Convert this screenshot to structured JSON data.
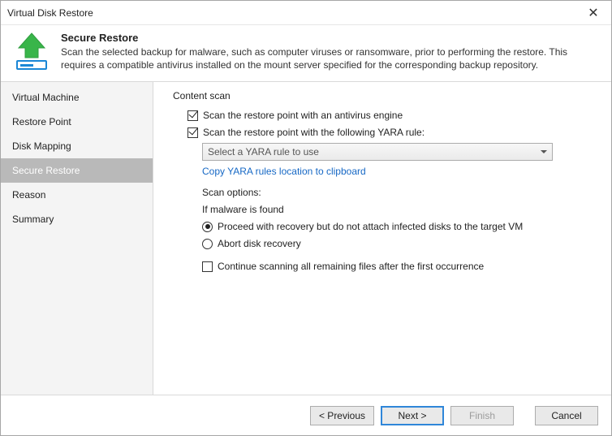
{
  "window": {
    "title": "Virtual Disk Restore"
  },
  "header": {
    "title": "Secure Restore",
    "desc": "Scan the selected backup for malware, such as computer viruses or ransomware, prior to performing the restore. This requires a compatible antivirus installed on the mount server specified for the corresponding backup repository."
  },
  "sidebar": {
    "items": [
      {
        "label": "Virtual Machine"
      },
      {
        "label": "Restore Point"
      },
      {
        "label": "Disk Mapping"
      },
      {
        "label": "Secure Restore"
      },
      {
        "label": "Reason"
      },
      {
        "label": "Summary"
      }
    ]
  },
  "content": {
    "group_label": "Content scan",
    "chk_av": "Scan the restore point with an antivirus engine",
    "chk_yara": "Scan the restore point with the following YARA rule:",
    "yara_dropdown": "Select a YARA rule to use",
    "yara_link": "Copy YARA rules location to clipboard",
    "scan_options_label": "Scan options:",
    "if_malware": "If malware is found",
    "radio_proceed": "Proceed with recovery but do not attach infected disks to the target VM",
    "radio_abort": "Abort disk recovery",
    "chk_continue": "Continue scanning all remaining files after the first occurrence"
  },
  "footer": {
    "previous": "< Previous",
    "next": "Next >",
    "finish": "Finish",
    "cancel": "Cancel"
  }
}
